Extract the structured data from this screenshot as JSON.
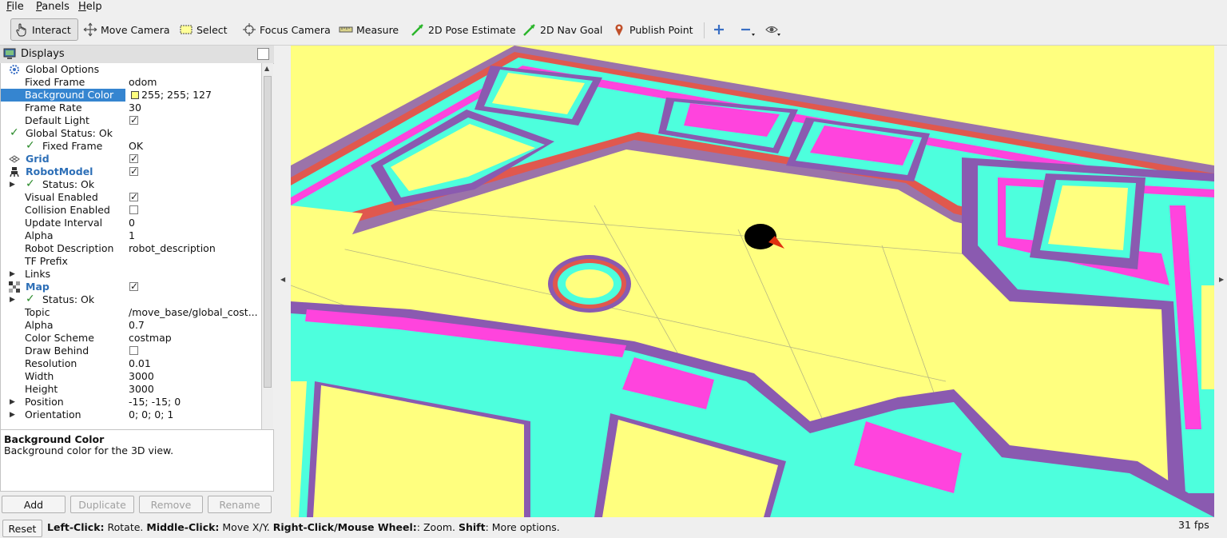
{
  "menu": [
    "File",
    "Panels",
    "Help"
  ],
  "toolbar": {
    "interact": "Interact",
    "move_camera": "Move Camera",
    "select": "Select",
    "focus_camera": "Focus Camera",
    "measure": "Measure",
    "pose_estimate": "2D Pose Estimate",
    "nav_goal": "2D Nav Goal",
    "publish_point": "Publish Point"
  },
  "displays": {
    "title": "Displays",
    "rows": [
      {
        "name": "Global Options",
        "value": ""
      },
      {
        "name": "Fixed Frame",
        "value": "odom"
      },
      {
        "name": "Background Color",
        "value": "255; 255; 127"
      },
      {
        "name": "Frame Rate",
        "value": "30"
      },
      {
        "name": "Default Light",
        "value": ""
      },
      {
        "name": "Global Status: Ok",
        "value": ""
      },
      {
        "name": "Fixed Frame",
        "value": "OK"
      },
      {
        "name": "Grid",
        "value": ""
      },
      {
        "name": "RobotModel",
        "value": ""
      },
      {
        "name": "Status: Ok",
        "value": ""
      },
      {
        "name": "Visual Enabled",
        "value": ""
      },
      {
        "name": "Collision Enabled",
        "value": ""
      },
      {
        "name": "Update Interval",
        "value": "0"
      },
      {
        "name": "Alpha",
        "value": "1"
      },
      {
        "name": "Robot Description",
        "value": "robot_description"
      },
      {
        "name": "TF Prefix",
        "value": ""
      },
      {
        "name": "Links",
        "value": ""
      },
      {
        "name": "Map",
        "value": ""
      },
      {
        "name": "Status: Ok",
        "value": ""
      },
      {
        "name": "Topic",
        "value": "/move_base/global_cost..."
      },
      {
        "name": "Alpha",
        "value": "0.7"
      },
      {
        "name": "Color Scheme",
        "value": "costmap"
      },
      {
        "name": "Draw Behind",
        "value": ""
      },
      {
        "name": "Resolution",
        "value": "0.01"
      },
      {
        "name": "Width",
        "value": "3000"
      },
      {
        "name": "Height",
        "value": "3000"
      },
      {
        "name": "Position",
        "value": "-15; -15; 0"
      },
      {
        "name": "Orientation",
        "value": "0; 0; 0; 1"
      }
    ]
  },
  "description": {
    "title": "Background Color",
    "text": "Background color for the 3D view."
  },
  "buttons": {
    "add": "Add",
    "duplicate": "Duplicate",
    "remove": "Remove",
    "rename": "Rename"
  },
  "status": {
    "reset": "Reset",
    "hint_k1": "Left-Click:",
    "hint_v1": " Rotate. ",
    "hint_k2": "Middle-Click:",
    "hint_v2": " Move X/Y. ",
    "hint_k3": "Right-Click/Mouse Wheel:",
    "hint_v3": ": Zoom. ",
    "hint_k4": "Shift",
    "hint_v4": ": More options.",
    "fps": "31 fps"
  },
  "colors": {
    "background": "#ffff7f",
    "inflation": "#4dffdd",
    "lethal": "#ff44dd",
    "gradient_edge": "#8a5ab0",
    "selection": "#3585d0"
  }
}
